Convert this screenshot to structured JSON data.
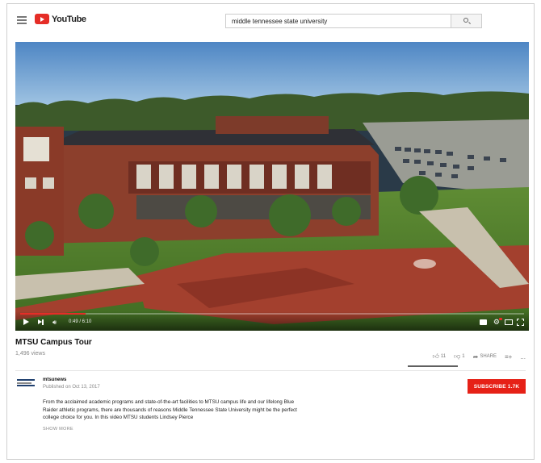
{
  "header": {
    "logo_text": "YouTube",
    "search_value": "middle tennessee state university",
    "icons": [
      "menu-icon",
      "youtube-logo",
      "search-icon"
    ]
  },
  "player": {
    "time": "0:49 / 6:10",
    "progress_fraction": 0.13,
    "controls": [
      "play-icon",
      "next-icon",
      "volume-icon",
      "captions-icon",
      "settings-icon",
      "theater-icon",
      "fullscreen-icon"
    ],
    "colors": {
      "progress": "#e52d27"
    }
  },
  "video": {
    "title": "MTSU Campus Tour",
    "views": "1,496 views",
    "likes": "11",
    "dislikes": "1",
    "share_label": "SHARE",
    "add_label": "",
    "more_label": "..."
  },
  "channel": {
    "name": "mtsunews",
    "published": "Published on Oct 13, 2017",
    "subscribe_label": "SUBSCRIBE 1.7K",
    "subscribe_color": "#e62117"
  },
  "description": {
    "text": "From the acclaimed academic programs and state-of-the-art facilities to MTSU campus life and our lifelong Blue Raider athletic programs, there are thousands of reasons Middle Tennessee State University might be the perfect college choice for you. In this video MTSU students Lindsey Pierce",
    "show_more": "SHOW MORE"
  }
}
